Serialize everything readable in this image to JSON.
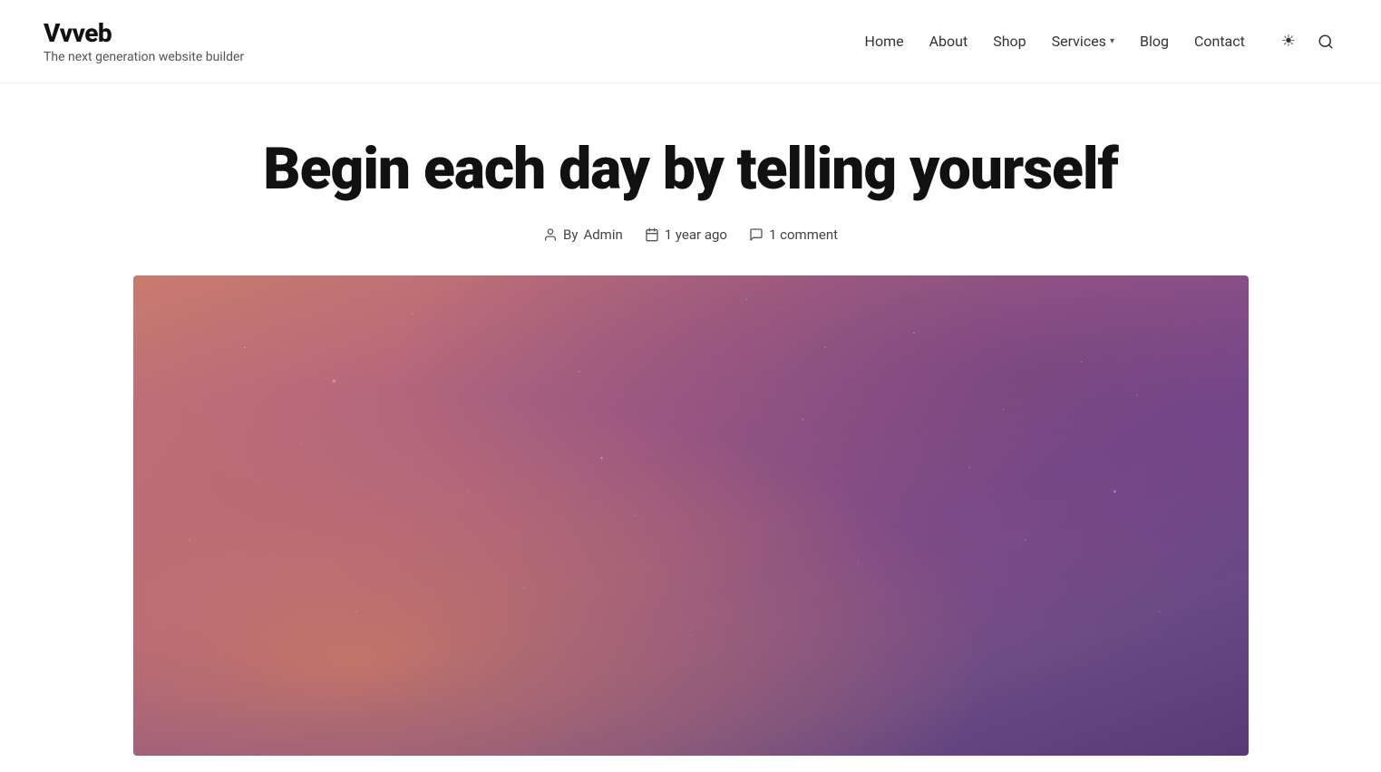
{
  "site": {
    "title": "Vvveb",
    "tagline": "The next generation website builder"
  },
  "nav": {
    "items": [
      {
        "label": "Home",
        "id": "home"
      },
      {
        "label": "About",
        "id": "about"
      },
      {
        "label": "Shop",
        "id": "shop"
      },
      {
        "label": "Services",
        "id": "services",
        "hasDropdown": true
      },
      {
        "label": "Blog",
        "id": "blog"
      },
      {
        "label": "Contact",
        "id": "contact"
      }
    ],
    "theme_toggle_icon": "☀",
    "search_icon": "🔍"
  },
  "post": {
    "title": "Begin each day by telling yourself",
    "author": "Admin",
    "date": "1 year ago",
    "comments": "1 comment",
    "author_label": "By",
    "author_icon": "👤",
    "date_icon": "📅",
    "comment_icon": "💬"
  }
}
